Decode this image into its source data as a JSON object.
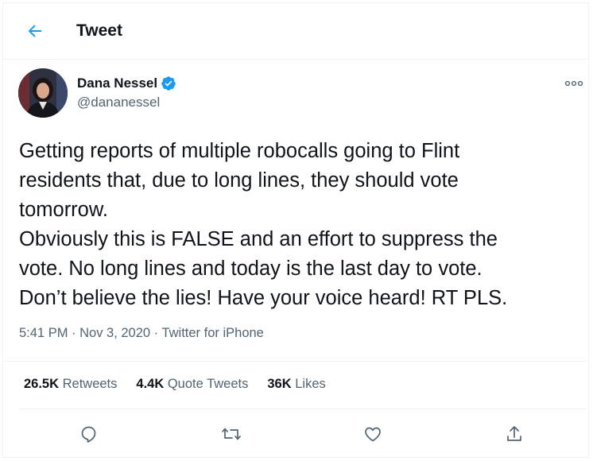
{
  "header": {
    "title": "Tweet",
    "back_icon": "arrow-left-icon"
  },
  "tweet": {
    "author_name": "Dana Nessel",
    "verified": true,
    "handle": "@dananessel",
    "text": "Getting reports of multiple robocalls going to Flint\nresidents that, due to long lines, they should vote\ntomorrow.\nObviously this is FALSE and an effort to suppress the\nvote. No long lines and today is the last day to vote.\nDon’t believe the lies! Have your voice heard! RT PLS.",
    "meta": "5:41 PM · Nov 3, 2020 · Twitter for iPhone"
  },
  "stats": {
    "retweets_count": "26.5K",
    "retweets_label": " Retweets",
    "quotes_count": "4.4K",
    "quotes_label": " Quote Tweets",
    "likes_count": "36K",
    "likes_label": " Likes"
  },
  "actions": [
    "reply-icon",
    "retweet-icon",
    "like-icon",
    "share-icon"
  ],
  "colors": {
    "accent": "#1d9bf0",
    "text_primary": "#0f1419",
    "text_secondary": "#536471",
    "border": "#eff3f4"
  }
}
